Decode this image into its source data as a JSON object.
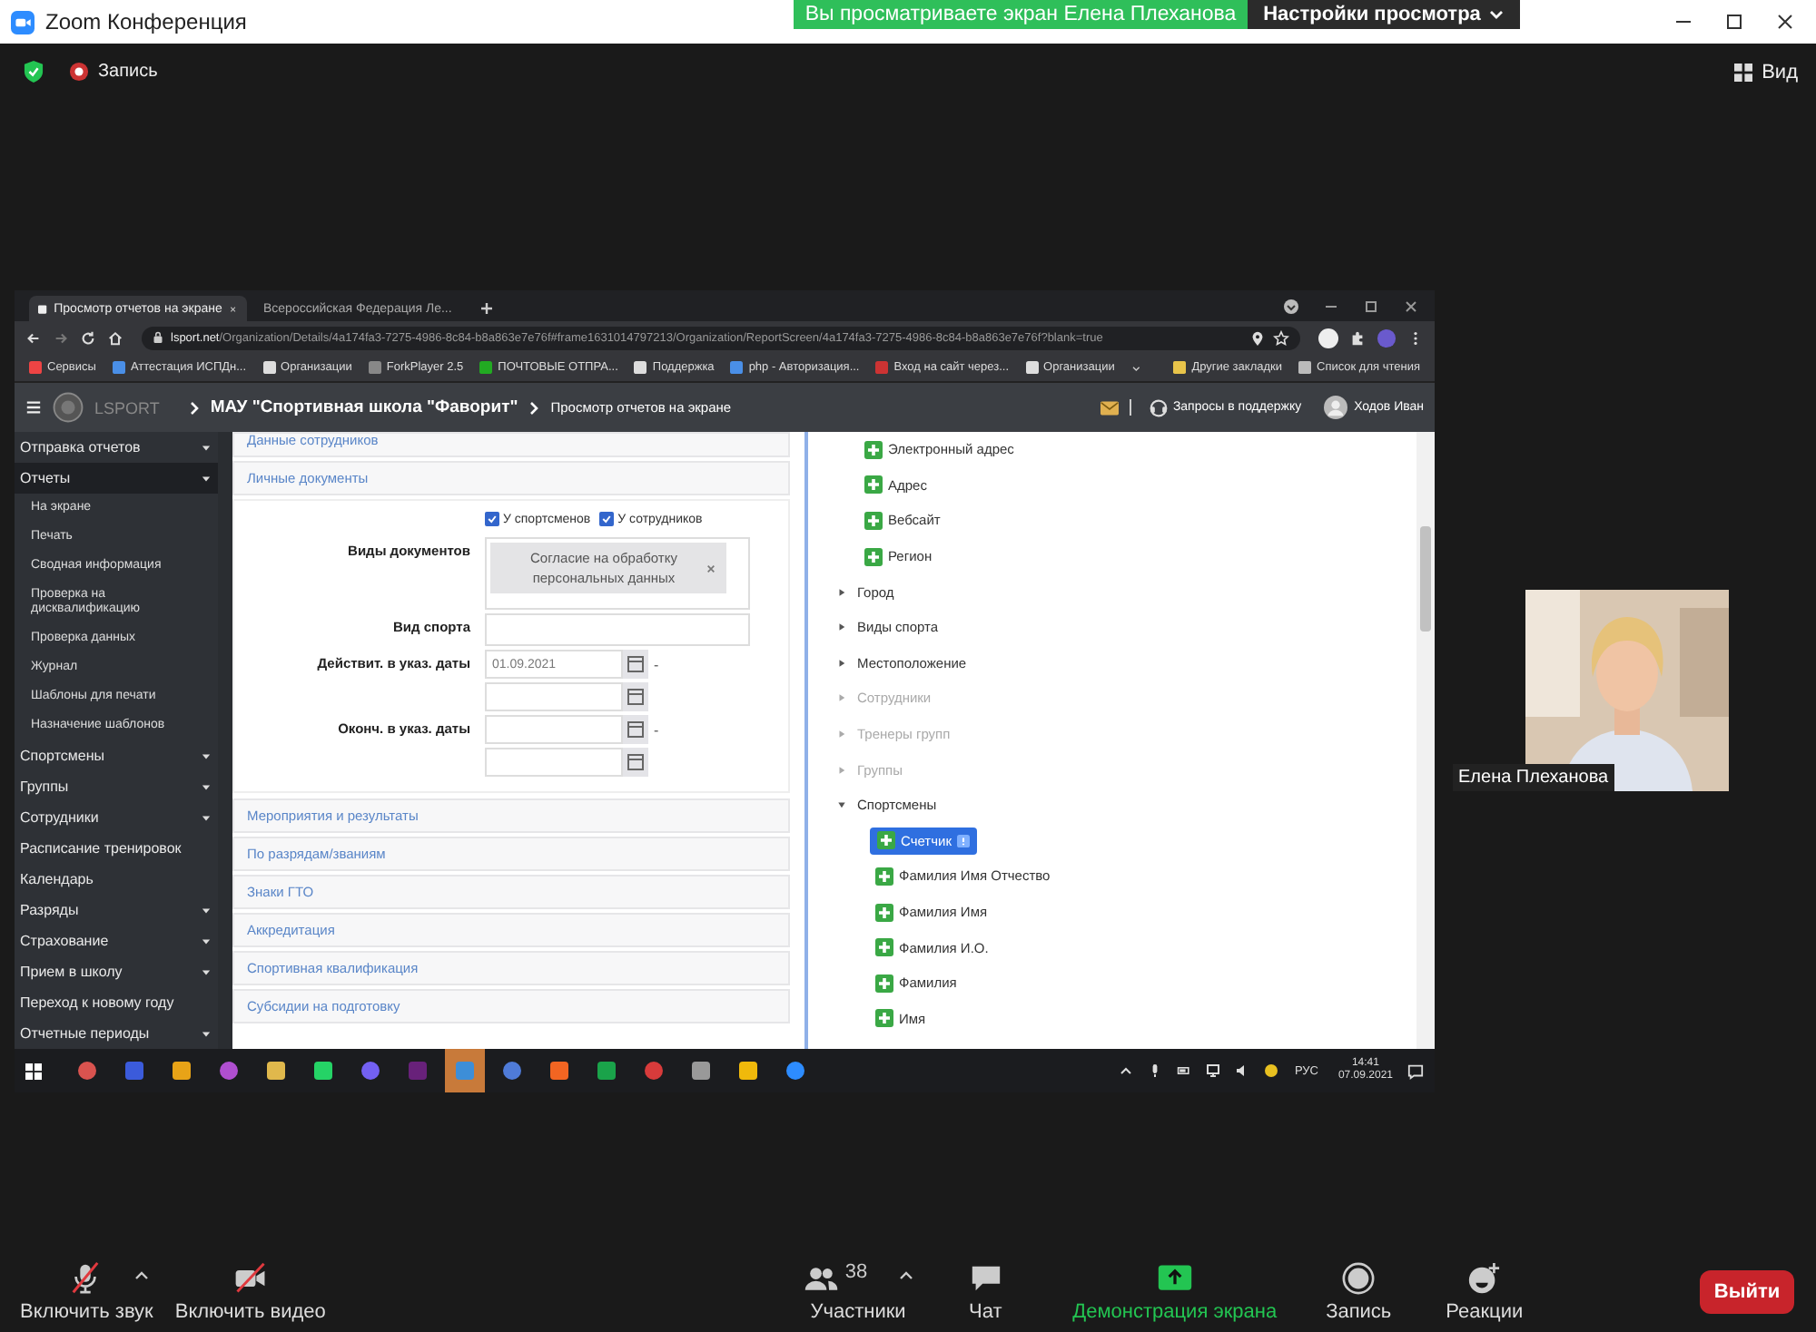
{
  "window": {
    "title": "Zoom Конференция",
    "banner": "Вы просматриваете экран Елена Плеханова",
    "view_options": "Настройки просмотра"
  },
  "top_bar": {
    "recording": "Запись",
    "view": "Вид"
  },
  "shared_screen": {
    "browser": {
      "tabs": [
        {
          "title": "Просмотр отчетов на экране",
          "selected": true
        },
        {
          "title": "Всероссийская Федерация Ле...",
          "selected": false
        }
      ],
      "url_host": "lsport.net",
      "url_path": "/Organization/Details/4a174fa3-7275-4986-8c84-b8a863e7e76f#frame1631014797213/Organization/ReportScreen/4a174fa3-7275-4986-8c84-b8a863e7e76f?blank=true",
      "bookmarks": [
        "Сервисы",
        "Аттестация ИСПДн...",
        "Организации",
        "ForkPlayer 2.5",
        "ПОЧТОВЫЕ ОТПРА...",
        "Поддержка",
        "php - Авторизация...",
        "Вход на сайт через...",
        "Организации"
      ],
      "bookmarks_right": [
        "Другие закладки",
        "Список для чтения"
      ]
    },
    "app_header": {
      "logo": "LSPORT",
      "organization": "МАУ \"Спортивная школа \"Фаворит\"",
      "page": "Просмотр отчетов на экране",
      "support": "Запросы в поддержку",
      "user": "Ходов Иван"
    },
    "sidebar": [
      {
        "label": "Отправка отчетов",
        "selected": false,
        "expandable": true
      },
      {
        "label": "Отчеты",
        "selected": true,
        "expandable": true,
        "children": [
          {
            "label": "На экране"
          },
          {
            "label": "Печать"
          },
          {
            "label": "Сводная информация"
          },
          {
            "label": "Проверка на дисквалификацию"
          },
          {
            "label": "Проверка данных"
          },
          {
            "label": "Журнал"
          },
          {
            "label": "Шаблоны для печати"
          },
          {
            "label": "Назначение шаблонов"
          }
        ]
      },
      {
        "label": "Спортсмены",
        "selected": false,
        "expandable": true
      },
      {
        "label": "Группы",
        "selected": false,
        "expandable": true
      },
      {
        "label": "Сотрудники",
        "selected": false,
        "expandable": true
      },
      {
        "label": "Расписание тренировок",
        "selected": false,
        "expandable": false
      },
      {
        "label": "Календарь",
        "selected": false,
        "expandable": false
      },
      {
        "label": "Разряды",
        "selected": false,
        "expandable": true
      },
      {
        "label": "Страхование",
        "selected": false,
        "expandable": true
      },
      {
        "label": "Прием в школу",
        "selected": false,
        "expandable": true
      },
      {
        "label": "Переход к новому году",
        "selected": false,
        "expandable": false
      },
      {
        "label": "Отчетные периоды",
        "selected": false,
        "expandable": true
      }
    ],
    "sections": [
      {
        "title": "Данные сотрудников"
      },
      {
        "title": "Личные документы",
        "form": {
          "checkboxes": [
            {
              "label": "У спортсменов",
              "checked": true
            },
            {
              "label": "У сотрудников",
              "checked": true
            }
          ],
          "rows": [
            {
              "label": "Виды документов",
              "kind": "tags",
              "tags": [
                "Согласие на обработку персональных данных"
              ]
            },
            {
              "label": "Вид спорта",
              "kind": "text"
            },
            {
              "label": "Действит. в указ. даты",
              "kind": "date_range",
              "from": "01.09.2021",
              "separator": "-"
            },
            {
              "label": "Оконч. в указ. даты",
              "kind": "date_range",
              "separator": "-"
            }
          ]
        }
      },
      {
        "title": "Мероприятия и результаты"
      },
      {
        "title": "По разрядам/званиям"
      },
      {
        "title": "Знаки ГТО"
      },
      {
        "title": "Аккредитация"
      },
      {
        "title": "Спортивная квалификация"
      },
      {
        "title": "Субсидии на подготовку"
      }
    ],
    "tree": [
      {
        "label": "Электронный адрес",
        "kind": "field",
        "selected": false,
        "info": false
      },
      {
        "label": "Адрес",
        "kind": "field",
        "selected": false,
        "info": false
      },
      {
        "label": "Вебсайт",
        "kind": "field",
        "selected": false,
        "info": false
      },
      {
        "label": "Регион",
        "kind": "field",
        "selected": false,
        "info": false
      },
      {
        "label": "Город",
        "kind": "group",
        "expanded": false,
        "disabled": false
      },
      {
        "label": "Виды спорта",
        "kind": "group",
        "expanded": false,
        "disabled": false
      },
      {
        "label": "Местоположение",
        "kind": "group",
        "expanded": false,
        "disabled": false
      },
      {
        "label": "Сотрудники",
        "kind": "group",
        "expanded": false,
        "disabled": true
      },
      {
        "label": "Тренеры групп",
        "kind": "group",
        "expanded": false,
        "disabled": true
      },
      {
        "label": "Группы",
        "kind": "group",
        "expanded": false,
        "disabled": true
      },
      {
        "label": "Спортсмены",
        "kind": "group",
        "expanded": true,
        "disabled": false,
        "children": [
          {
            "label": "Счетчик",
            "kind": "field",
            "selected": true,
            "info": true
          },
          {
            "label": "Фамилия Имя Отчество",
            "kind": "field",
            "selected": false,
            "info": false
          },
          {
            "label": "Фамилия Имя",
            "kind": "field",
            "selected": false,
            "info": false
          },
          {
            "label": "Фамилия И.О.",
            "kind": "field",
            "selected": false,
            "info": false
          },
          {
            "label": "Фамилия",
            "kind": "field",
            "selected": false,
            "info": false
          },
          {
            "label": "Имя",
            "kind": "field",
            "selected": false,
            "info": false
          }
        ]
      }
    ],
    "taskbar": {
      "language": "РУС",
      "time": "14:41",
      "date": "07.09.2021"
    }
  },
  "participant": {
    "name": "Елена Плеханова"
  },
  "toolbar": [
    {
      "label": "Включить звук",
      "kind": "mic",
      "crossed": true,
      "menu_caret": true,
      "highlighted": false
    },
    {
      "label": "Включить видео",
      "kind": "video",
      "crossed": true,
      "menu_caret": false,
      "highlighted": false
    },
    {
      "label": "Участники",
      "kind": "participants",
      "count": "38",
      "crossed": false,
      "menu_caret": true,
      "highlighted": false
    },
    {
      "label": "Чат",
      "kind": "chat",
      "crossed": false,
      "menu_caret": false,
      "highlighted": false
    },
    {
      "label": "Демонстрация экрана",
      "kind": "share",
      "crossed": false,
      "menu_caret": false,
      "highlighted": true
    },
    {
      "label": "Запись",
      "kind": "record",
      "crossed": false,
      "menu_caret": false,
      "highlighted": false
    },
    {
      "label": "Реакции",
      "kind": "reactions",
      "crossed": false,
      "menu_caret": false,
      "highlighted": false
    }
  ],
  "leave": "Выйти"
}
